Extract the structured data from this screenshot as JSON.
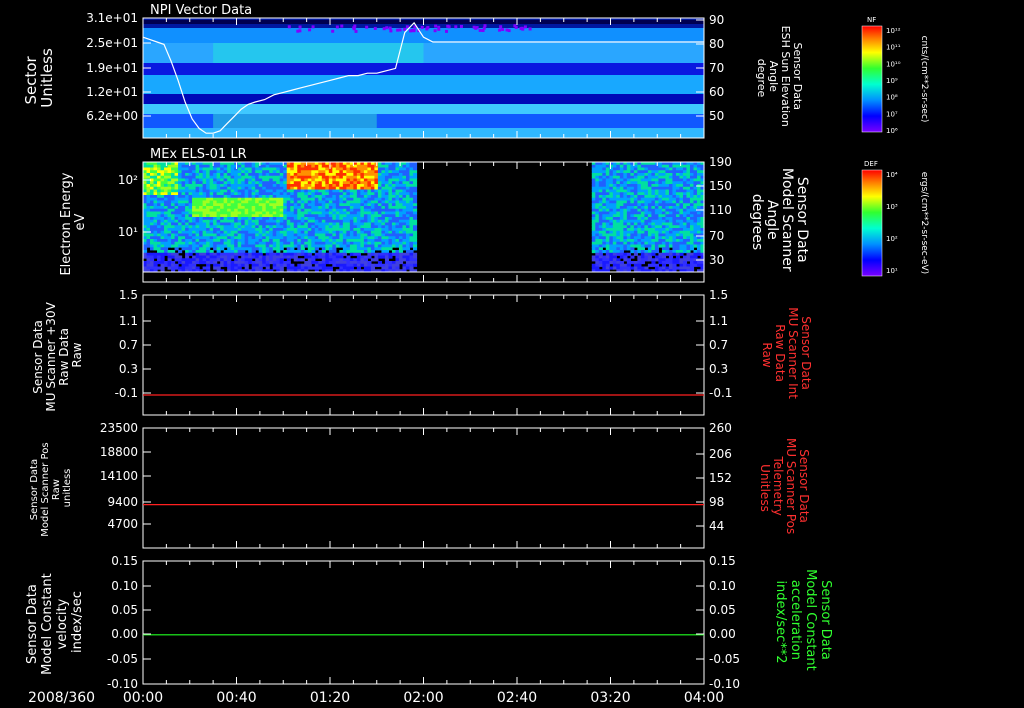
{
  "date_label": "2008/360",
  "time_ticks": [
    "00:00",
    "00:40",
    "01:20",
    "02:00",
    "02:40",
    "03:20",
    "04:00"
  ],
  "colors": {
    "background": "#000000",
    "axis": "#ffffff",
    "red_line": "#ff2020",
    "green_line": "#20ff20",
    "red_label": "#ff3030",
    "green_label": "#30ff30"
  },
  "colorbars": [
    {
      "tag": "NF",
      "units": "cnts/(cm**2-sr-sec)",
      "ticks": [
        "10¹²",
        "10¹¹",
        "10¹⁰",
        "10⁹",
        "10⁸",
        "10⁷",
        "10⁶"
      ]
    },
    {
      "tag": "DEF",
      "units": "ergs/(cm**2-sr-sec-eV)",
      "ticks": [
        "10⁴",
        "10³",
        "10²",
        "10¹"
      ]
    }
  ],
  "chart_data": [
    {
      "type": "heatmap",
      "title": "NPI Vector Data",
      "ylabel": [
        "Sector",
        "Unitless"
      ],
      "y_ticks": [
        "3.1e+01",
        "2.5e+01",
        "1.9e+01",
        "1.2e+01",
        "6.2e+00"
      ],
      "y2label": [
        "Sensor Data",
        "ESH Sun Elevation",
        "Angle",
        "degree"
      ],
      "y2_ticks": [
        "90",
        "80",
        "70",
        "60",
        "50"
      ],
      "y2_range": [
        40,
        90
      ],
      "overlay_line": {
        "name": "ESH Sun Elevation Angle",
        "color": "#ffffff",
        "x_minutes": [
          0,
          3,
          6,
          9,
          12,
          15,
          18,
          21,
          24,
          27,
          30,
          33,
          36,
          39,
          42,
          45,
          48,
          52,
          56,
          60,
          64,
          68,
          72,
          76,
          80,
          84,
          88,
          92,
          96,
          100,
          104,
          108,
          112,
          116,
          120,
          124,
          128,
          132,
          136,
          140,
          144,
          148,
          152,
          156,
          160,
          165,
          170,
          175,
          180,
          185,
          190,
          195,
          200,
          205,
          210,
          215,
          220,
          225,
          230,
          235,
          240
        ],
        "y_degrees": [
          82,
          81,
          80,
          79,
          72,
          64,
          55,
          48,
          44,
          42,
          42,
          43,
          46,
          49,
          52,
          54,
          55,
          56,
          58,
          59,
          60,
          61,
          62,
          63,
          64,
          65,
          66,
          66,
          67,
          67,
          68,
          69,
          84,
          88,
          82,
          80,
          80,
          80,
          80,
          80,
          80,
          80,
          80,
          80,
          80,
          80,
          80,
          80,
          80,
          80,
          80,
          80,
          80,
          80,
          80,
          80,
          80,
          80,
          80,
          80,
          80
        ]
      }
    },
    {
      "type": "heatmap",
      "title": "MEx ELS-01 LR",
      "ylabel": [
        "Electron Energy",
        "eV"
      ],
      "y_ticks": [
        "10²",
        "10¹"
      ],
      "y2label": [
        "Sensor Data",
        "Model Scanner",
        "Angle",
        "degrees"
      ],
      "y2_ticks": [
        "190",
        "150",
        "110",
        "70",
        "30"
      ],
      "data_segments": [
        {
          "start": "00:00",
          "end": "01:57"
        },
        {
          "start": "03:12",
          "end": "04:00"
        }
      ]
    },
    {
      "type": "line",
      "ylabel": [
        "Sensor Data",
        "MU Scanner +30V",
        "Raw Data",
        "Raw"
      ],
      "y_ticks": [
        "1.5",
        "1.1",
        "0.7",
        "0.3",
        "-0.1"
      ],
      "y2label": [
        "Sensor Data",
        "MU Scanner Int",
        "Raw Data",
        "Raw"
      ],
      "y2_ticks": [
        "1.5",
        "1.1",
        "0.7",
        "0.3",
        "-0.1"
      ],
      "ylim": [
        -0.3,
        1.5
      ],
      "series": [
        {
          "color": "#ff2020",
          "x": [
            "00:00",
            "04:00"
          ],
          "values": [
            0.0,
            0.0
          ]
        }
      ]
    },
    {
      "type": "line",
      "ylabel": [
        "Sensor Data",
        "Model Scanner Pos",
        "Raw",
        "unitless"
      ],
      "y_ticks": [
        "23500",
        "18800",
        "14100",
        "9400",
        "4700"
      ],
      "y2label": [
        "Sensor Data",
        "MU Scanner Pos",
        "Telemetry",
        "Unitless"
      ],
      "y2_ticks": [
        "260",
        "206",
        "152",
        "98",
        "44"
      ],
      "ylim": [
        0,
        23500
      ],
      "series": [
        {
          "color": "#ff2020",
          "x": [
            "00:00",
            "04:00"
          ],
          "values": [
            8500,
            8500
          ]
        }
      ]
    },
    {
      "type": "line",
      "ylabel": [
        "Sensor Data",
        "Model Constant",
        "velocity",
        "index/sec"
      ],
      "y_ticks": [
        "0.15",
        "0.10",
        "0.05",
        "0.00",
        "-0.05",
        "-0.10"
      ],
      "y2label": [
        "Sensor Data",
        "Model Constant",
        "acceleration",
        "index/sec**2"
      ],
      "y2_ticks": [
        "0.15",
        "0.10",
        "0.05",
        "0.00",
        "-0.05",
        "-0.10"
      ],
      "ylim": [
        -0.1,
        0.15
      ],
      "series": [
        {
          "color": "#20ff20",
          "x": [
            "00:00",
            "04:00"
          ],
          "values": [
            0.0,
            0.0
          ]
        }
      ]
    }
  ]
}
